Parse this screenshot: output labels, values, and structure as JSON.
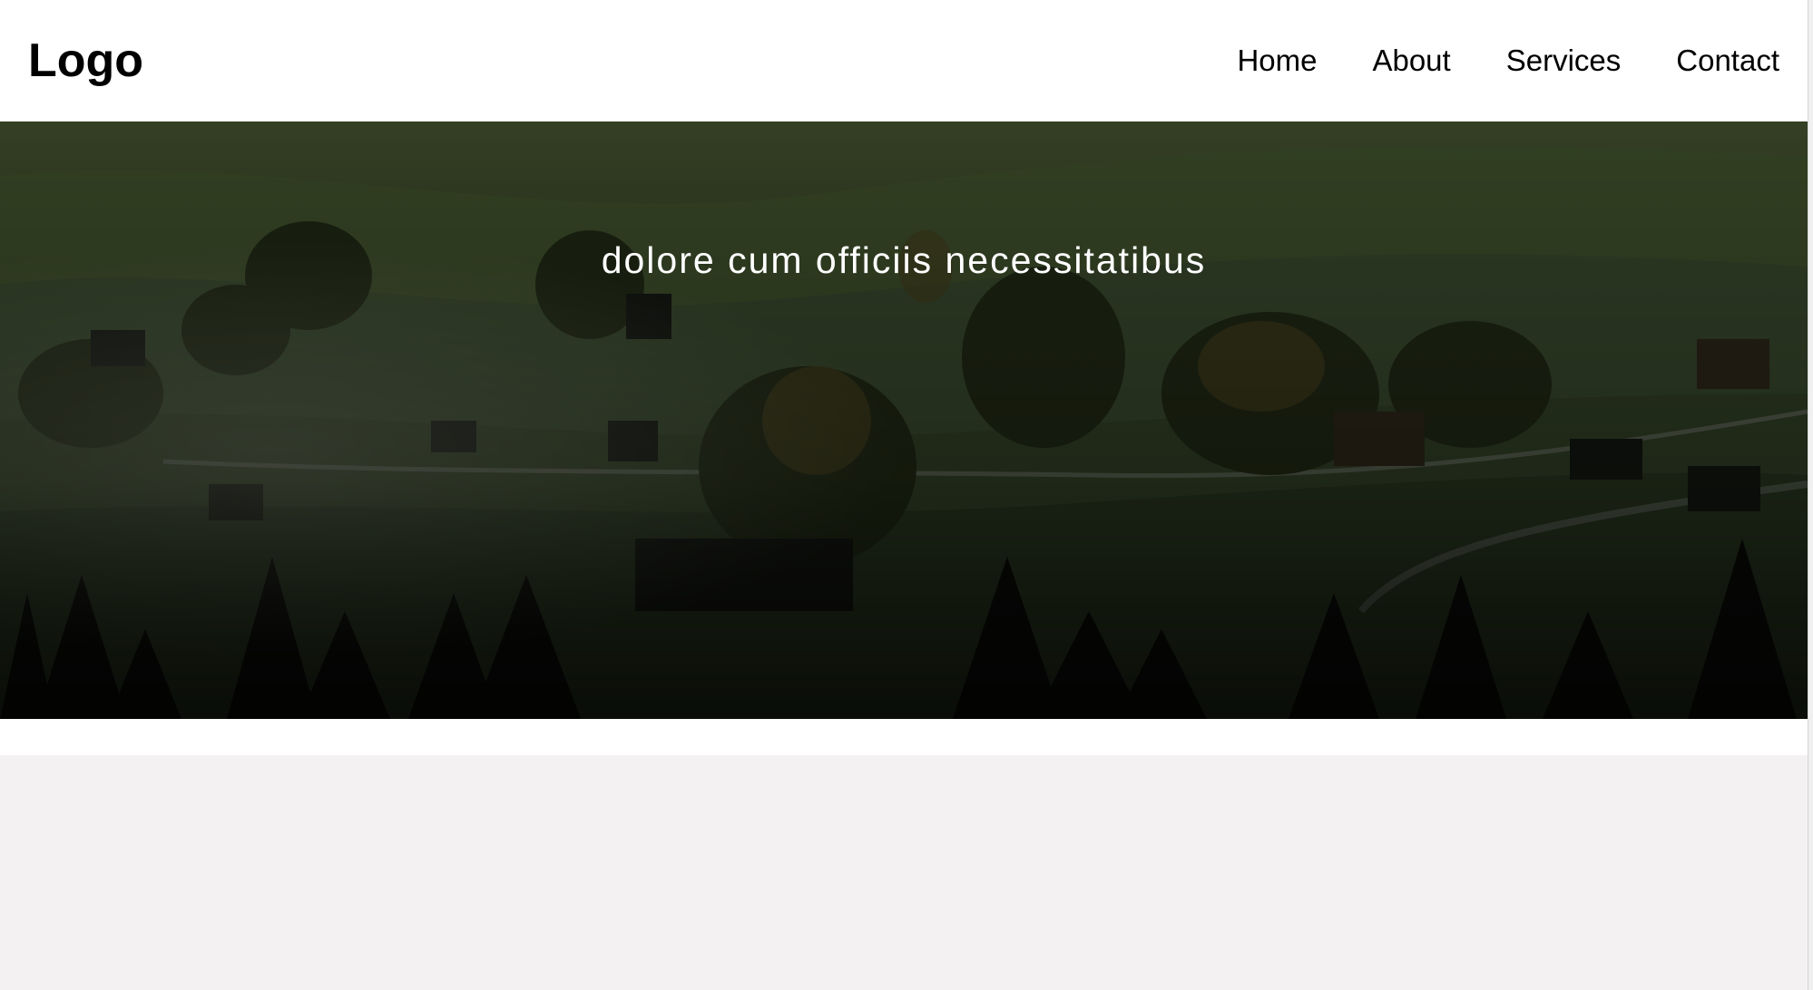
{
  "header": {
    "logo": "Logo",
    "nav": [
      {
        "label": "Home"
      },
      {
        "label": "About"
      },
      {
        "label": "Services"
      },
      {
        "label": "Contact"
      }
    ]
  },
  "hero": {
    "text": "dolore cum officiis necessitatibus",
    "image_icon": "landscape-photo"
  },
  "colors": {
    "header_bg": "#ffffff",
    "text": "#000000",
    "hero_text": "#ffffff",
    "lower_bg": "#f3f1f2"
  }
}
